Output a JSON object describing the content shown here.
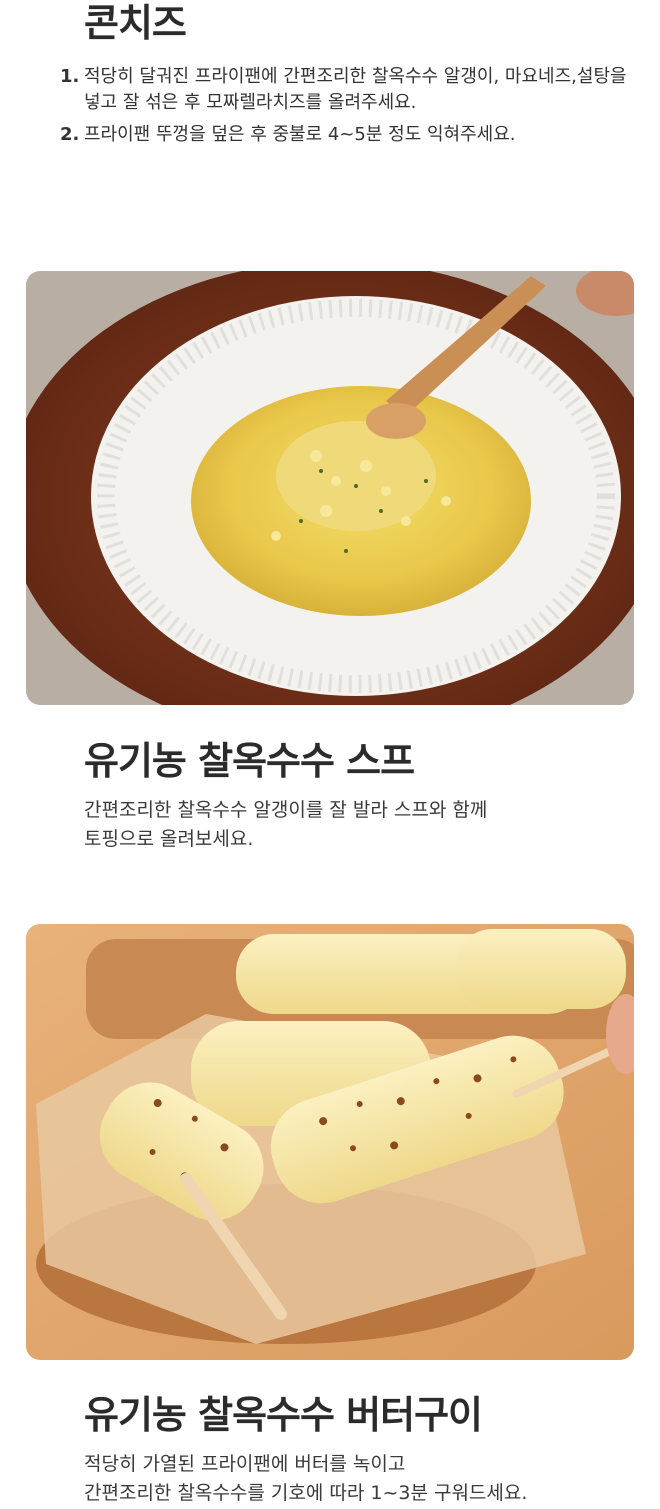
{
  "cheese": {
    "title": "콘치즈",
    "steps": [
      {
        "num": "1.",
        "text": "적당히 달궈진 프라이팬에 간편조리한 찰옥수수 알갱이, 마요네즈,설탕을 넣고 잘 섞은 후 모짜렐라치즈를 올려주세요."
      },
      {
        "num": "2.",
        "text": "프라이팬 뚜껑을 덮은 후 중불로 4~5분 정도 익혀주세요."
      }
    ]
  },
  "soup": {
    "title": "유기농 찰옥수수 스프",
    "desc_line1": "간편조리한 찰옥수수 알갱이를 잘 발라 스프와 함께",
    "desc_line2": "토핑으로 올려보세요."
  },
  "butter": {
    "title": "유기농 찰옥수수 버터구이",
    "desc_line1": "적당히 가열된 프라이팬에 버터를 녹이고",
    "desc_line2": "간편조리한 찰옥수수를 기호에 따라 1~3분 구워드세요."
  }
}
